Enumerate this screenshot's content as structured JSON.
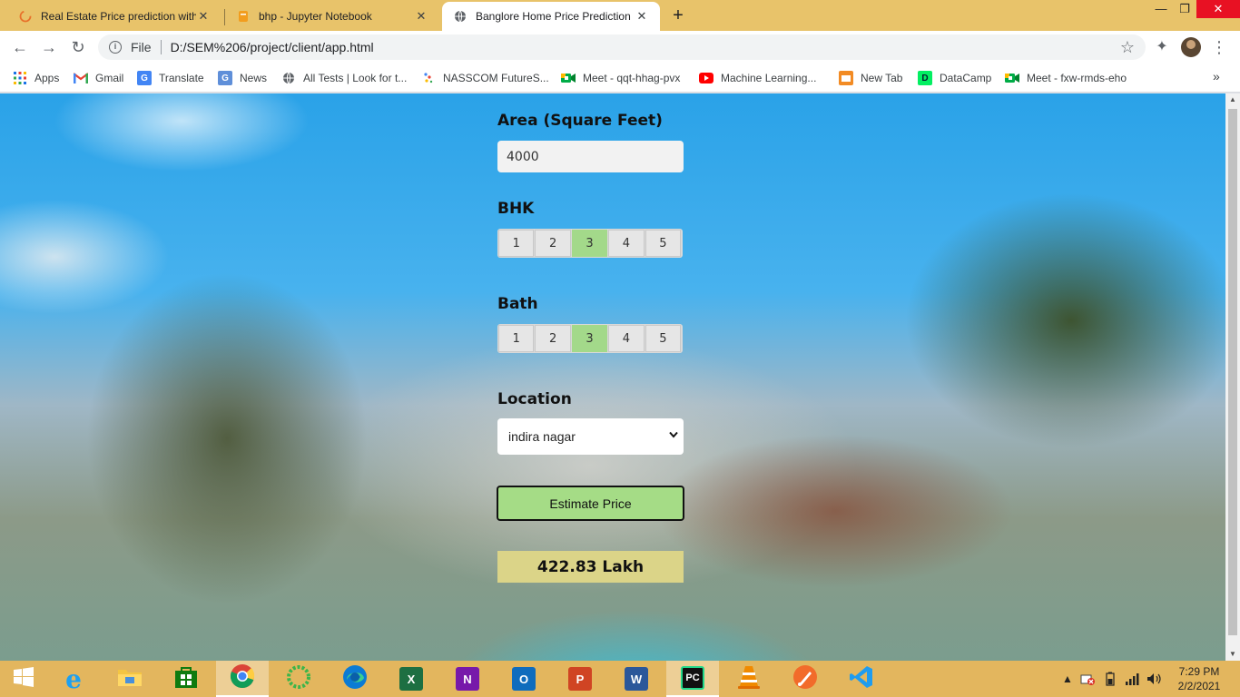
{
  "browser": {
    "tabs": [
      {
        "title": "Real Estate Price prediction with",
        "icon": "spinner-orange-icon",
        "close": "✕"
      },
      {
        "title": "bhp - Jupyter Notebook",
        "icon": "notebook-icon",
        "close": "✕"
      },
      {
        "title": "Banglore Home Price Prediction",
        "icon": "globe-icon",
        "close": "✕"
      }
    ],
    "new_tab": "+",
    "window_controls": {
      "minimize": "—",
      "maximize": "❐",
      "close": "✕"
    },
    "nav": {
      "back": "←",
      "forward": "→",
      "reload": "↻"
    },
    "omnibox": {
      "scheme": "File",
      "url": "D:/SEM%206/project/client/app.html",
      "info_icon": "i",
      "star": "☆"
    },
    "extensions_icon": "✦",
    "menu": "⋮"
  },
  "bookmarks": {
    "items": [
      {
        "label": "Apps",
        "icon": "apps-grid-icon"
      },
      {
        "label": "Gmail",
        "icon": "gmail-icon"
      },
      {
        "label": "Translate",
        "icon": "translate-icon"
      },
      {
        "label": "News",
        "icon": "news-icon"
      },
      {
        "label": "All Tests | Look for t...",
        "icon": "globe-icon"
      },
      {
        "label": "NASSCOM FutureS...",
        "icon": "nasscom-icon"
      },
      {
        "label": "Meet - qqt-hhag-pvx",
        "icon": "meet-icon"
      },
      {
        "label": "Machine Learning...",
        "icon": "youtube-icon"
      },
      {
        "label": "New Tab",
        "icon": "newtab-icon"
      },
      {
        "label": "DataCamp",
        "icon": "datacamp-icon"
      },
      {
        "label": "Meet - fxw-rmds-eho",
        "icon": "meet-icon"
      }
    ],
    "more": "»"
  },
  "form": {
    "area_label": "Area (Square Feet)",
    "area_value": "4000",
    "bhk_label": "BHK",
    "bhk_options": [
      "1",
      "2",
      "3",
      "4",
      "5"
    ],
    "bhk_selected": "3",
    "bath_label": "Bath",
    "bath_options": [
      "1",
      "2",
      "3",
      "4",
      "5"
    ],
    "bath_selected": "3",
    "location_label": "Location",
    "location_value": "indira nagar",
    "estimate_button": "Estimate Price",
    "result": "422.83 Lakh"
  },
  "colors": {
    "selected_segment": "#a3d98a",
    "estimate_button": "#a5dc86",
    "result_box": "#dbd488",
    "tab_strip": "#e8c36a",
    "taskbar": "#e3b65e"
  },
  "taskbar": {
    "apps": [
      {
        "name": "start-icon"
      },
      {
        "name": "internet-explorer-icon",
        "glyph": "e"
      },
      {
        "name": "file-explorer-icon"
      },
      {
        "name": "store-icon"
      },
      {
        "name": "chrome-icon"
      },
      {
        "name": "green-ring-icon"
      },
      {
        "name": "edge-icon"
      },
      {
        "name": "excel-icon",
        "glyph": "X"
      },
      {
        "name": "onenote-icon",
        "glyph": "N"
      },
      {
        "name": "outlook-icon",
        "glyph": "O"
      },
      {
        "name": "powerpoint-icon",
        "glyph": "P"
      },
      {
        "name": "word-icon",
        "glyph": "W"
      },
      {
        "name": "pycharm-icon",
        "glyph": "PC"
      },
      {
        "name": "vlc-icon"
      },
      {
        "name": "paint-brush-icon"
      },
      {
        "name": "vscode-icon"
      }
    ],
    "tray_up": "▲",
    "time": "7:29 PM",
    "date": "2/2/2021"
  }
}
